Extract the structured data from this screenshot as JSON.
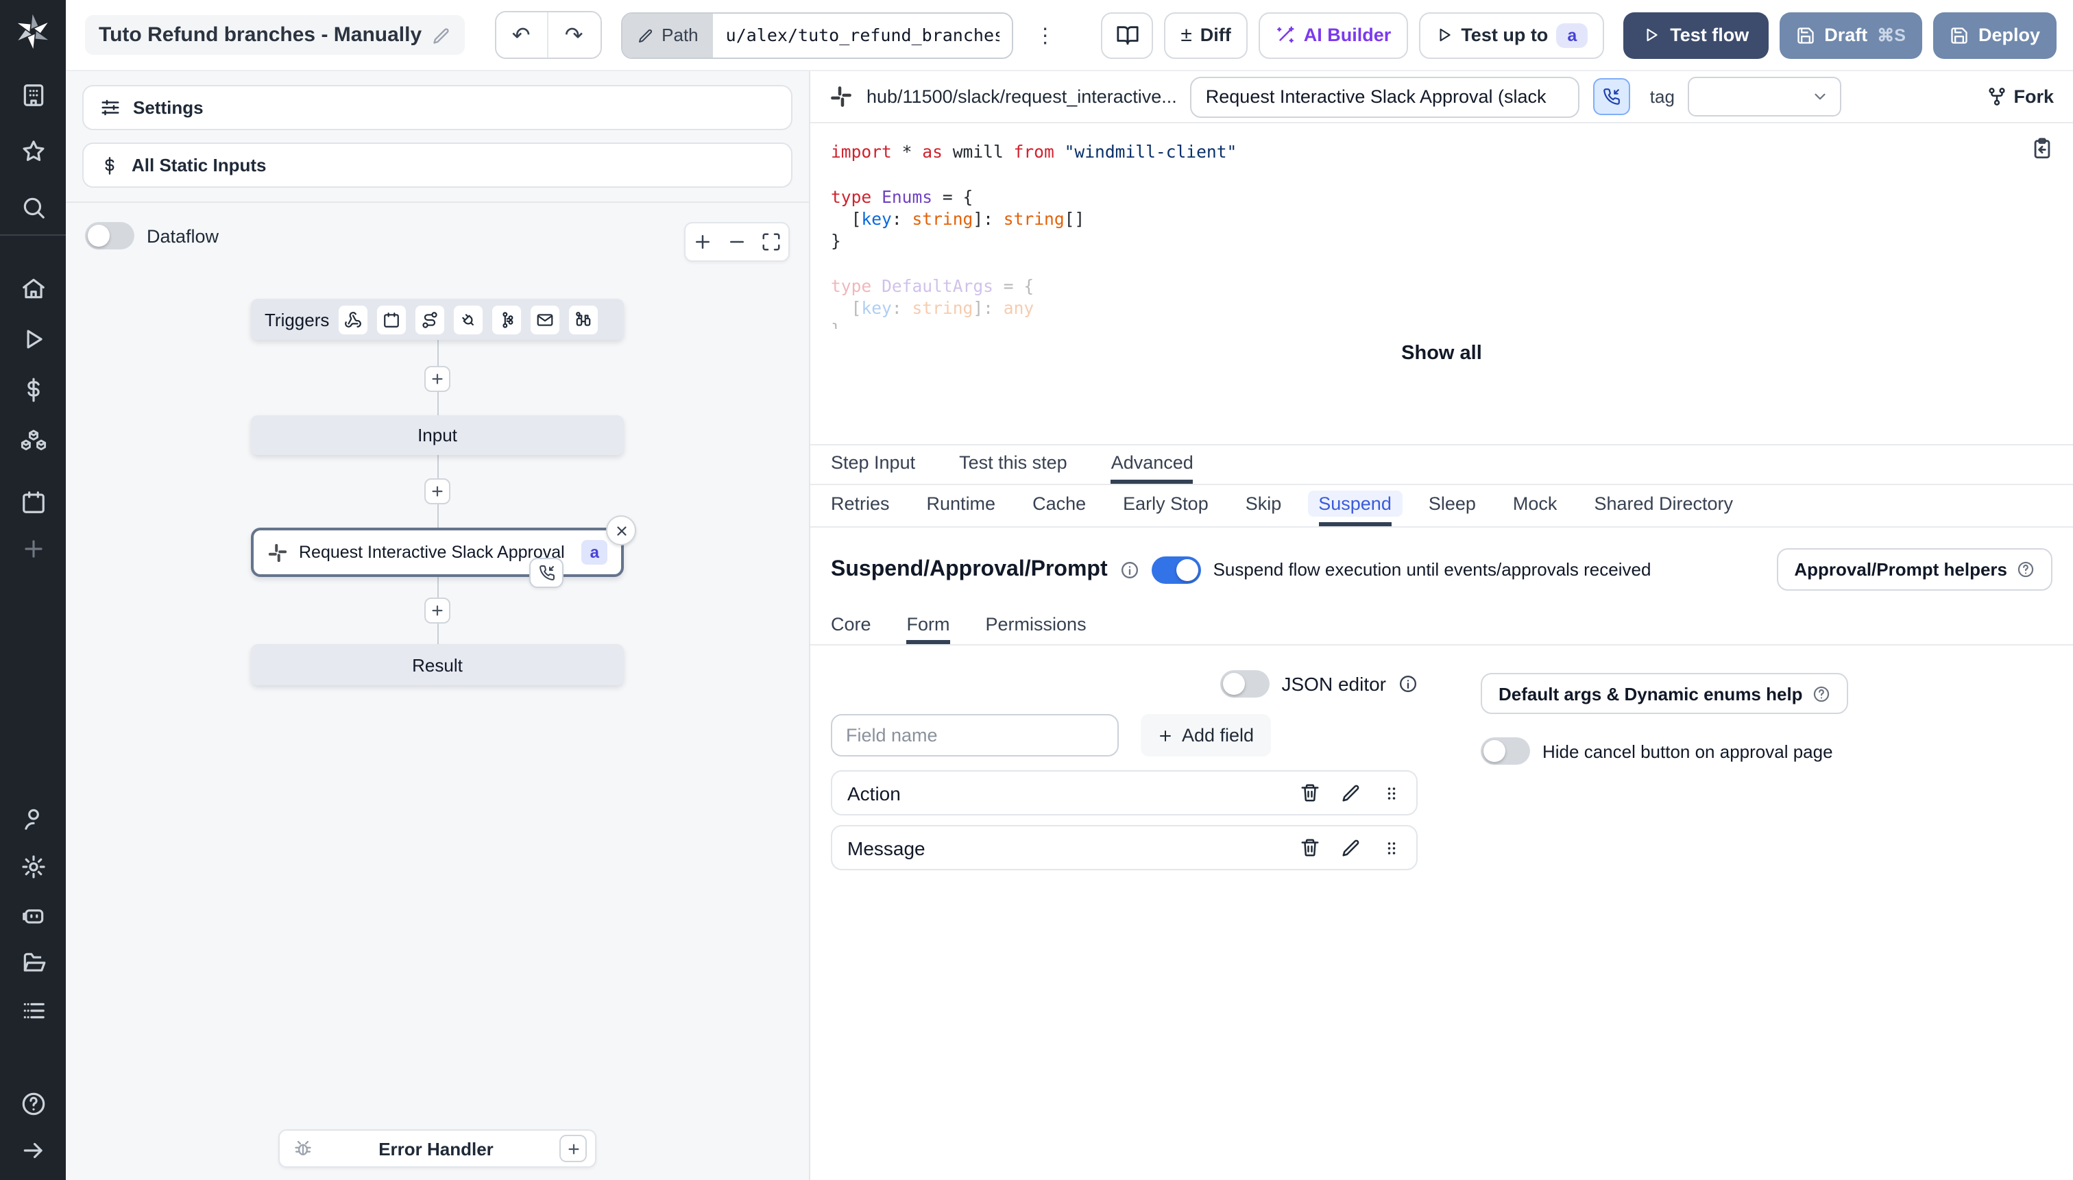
{
  "topbar": {
    "title": "Tuto Refund branches - Manually",
    "path_label": "Path",
    "path_value": "u/alex/tuto_refund_branches__",
    "diff_sign": "±",
    "diff_label": "Diff",
    "ai_builder_label": "AI Builder",
    "test_up_to_label": "Test up to",
    "test_up_to_badge": "a",
    "test_flow_label": "Test flow",
    "draft_label": "Draft",
    "draft_shortcut": "⌘S",
    "deploy_label": "Deploy"
  },
  "sidebar": {
    "icons": [
      "windmill-logo",
      "workspace-icon",
      "favorites-star-icon",
      "search-icon",
      "home-icon",
      "runs-play-icon",
      "variables-dollar-icon",
      "resources-cubes-icon",
      "schedules-calendar-icon",
      "add-plus-icon",
      "user-icon",
      "settings-gear-icon",
      "ai-robot-icon",
      "folders-icon",
      "worker-groups-list-icon",
      "help-icon",
      "expand-arrow-icon"
    ]
  },
  "left_panel": {
    "settings_label": "Settings",
    "static_inputs_label": "All Static Inputs",
    "dataflow_label": "Dataflow",
    "flow": {
      "triggers_label": "Triggers",
      "input_label": "Input",
      "step_label": "Request Interactive Slack Approval (...",
      "step_badge": "a",
      "result_label": "Result",
      "error_handler_label": "Error Handler"
    }
  },
  "right_panel": {
    "header": {
      "hub_path": "hub/11500/slack/request_interactive...",
      "title_value": "Request Interactive Slack Approval (slack",
      "tag_label": "tag",
      "fork_label": "Fork"
    },
    "code": {
      "show_all": "Show all",
      "faded_from": 6,
      "lines": [
        [
          [
            "kw",
            "import"
          ],
          [
            "pl",
            " * "
          ],
          [
            "kw",
            "as"
          ],
          [
            "pl",
            " wmill "
          ],
          [
            "kw",
            "from"
          ],
          [
            "pl",
            " "
          ],
          [
            "str",
            "\"windmill-client\""
          ]
        ],
        [],
        [
          [
            "kw",
            "type"
          ],
          [
            "pl",
            " "
          ],
          [
            "ty",
            "Enums"
          ],
          [
            "pl",
            " = {"
          ]
        ],
        [
          [
            "pl",
            "  ["
          ],
          [
            "prop",
            "key"
          ],
          [
            "pl",
            ": "
          ],
          [
            "or",
            "string"
          ],
          [
            "pl",
            "]: "
          ],
          [
            "or",
            "string"
          ],
          [
            "pl",
            "[]"
          ]
        ],
        [
          [
            "pl",
            "}"
          ]
        ],
        [],
        [
          [
            "kw",
            "type"
          ],
          [
            "pl",
            " "
          ],
          [
            "ty",
            "DefaultArgs"
          ],
          [
            "pl",
            " = {"
          ]
        ],
        [
          [
            "pl",
            "  ["
          ],
          [
            "prop",
            "key"
          ],
          [
            "pl",
            ": "
          ],
          [
            "or",
            "string"
          ],
          [
            "pl",
            "]: "
          ],
          [
            "or",
            "any"
          ]
        ],
        [
          [
            "pl",
            "}"
          ]
        ]
      ]
    },
    "tabs": [
      "Step Input",
      "Test this step",
      "Advanced"
    ],
    "advanced_tabs": [
      "Retries",
      "Runtime",
      "Cache",
      "Early Stop",
      "Skip",
      "Suspend",
      "Sleep",
      "Mock",
      "Shared Directory"
    ],
    "suspend": {
      "heading": "Suspend/Approval/Prompt",
      "toggle_desc": "Suspend flow execution until events/approvals received",
      "helpers_label": "Approval/Prompt helpers",
      "sub_tabs": [
        "Core",
        "Form",
        "Permissions"
      ],
      "json_editor_label": "JSON editor",
      "field_placeholder": "Field name",
      "add_field_label": "Add field",
      "fields": [
        "Action",
        "Message"
      ],
      "default_args_label": "Default args & Dynamic enums help",
      "hide_cancel_label": "Hide cancel button on approval page"
    }
  },
  "colors": {
    "sidebar_bg": "#1f242b",
    "test_flow_bg": "#3d4c6d",
    "deploy_bg": "#7089ad",
    "suspend_tab_text": "#3b5bdb",
    "toggle_on": "#3273e8",
    "node_border_selected": "#64748b"
  }
}
